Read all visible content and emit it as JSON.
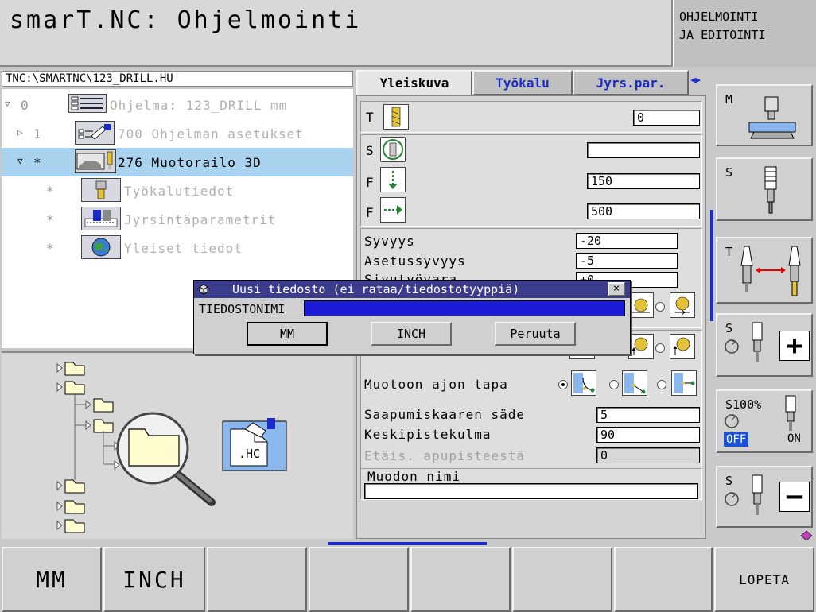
{
  "header": {
    "title": "smarT.NC: Ohjelmointi",
    "mode": "OHJELMOINTI\nJA EDITOINTI"
  },
  "tree": {
    "path": "TNC:\\SMARTNC\\123_DRILL.HU",
    "items": [
      {
        "num": "0",
        "label": "Ohjelma: 123_DRILL mm",
        "icon": "program-icon"
      },
      {
        "num": "1",
        "label": "700 Ohjelman asetukset",
        "icon": "program-settings-icon"
      },
      {
        "num": "*",
        "label": "276 Muotorailo 3D",
        "icon": "contour-train-icon"
      },
      {
        "num": "*",
        "label": "Työkalutiedot",
        "icon": "tool-data-icon"
      },
      {
        "num": "*",
        "label": "Jyrsintäparametrit",
        "icon": "milling-params-icon"
      },
      {
        "num": "*",
        "label": "Yleiset tiedot",
        "icon": "global-data-icon"
      }
    ]
  },
  "preview": {
    "file_ext": ".HC"
  },
  "tabs": [
    {
      "label": "Yleiskuva"
    },
    {
      "label": "Työkalu"
    },
    {
      "label": "Jyrs.par."
    }
  ],
  "form": {
    "tool": {
      "label": "T",
      "value": "0"
    },
    "spindle": {
      "label": "S",
      "value": ""
    },
    "feed_plunge": {
      "label": "F",
      "value": "150"
    },
    "feed_mill": {
      "label": "F",
      "value": "500"
    },
    "depth": {
      "label": "Syvyys",
      "value": "-20"
    },
    "plunge_depth": {
      "label": "Asetussyvyys",
      "value": "-5"
    },
    "third_partial": {
      "label": "Sivutyövara",
      "value": "+0"
    },
    "approach_mode": {
      "label": "Muotoon ajon tapa"
    },
    "approach_radius": {
      "label": "Saapumiskaaren säde",
      "value": "5"
    },
    "center_angle": {
      "label": "Keskipistekulma",
      "value": "90"
    },
    "aux_distance": {
      "label": "Etäis. apupisteestä",
      "value": "0"
    },
    "contour_name": {
      "label": "Muodon nimi",
      "value": ""
    }
  },
  "side_keys": {
    "m": "M",
    "s1": "S",
    "t": "T",
    "s2": "S",
    "s100": "S100%",
    "off": "OFF",
    "on": "ON",
    "s3": "S"
  },
  "bottom_keys": {
    "mm": "MM",
    "inch": "INCH",
    "exit": "LOPETA"
  },
  "dialog": {
    "title": "Uusi tiedosto (ei rataa/tiedostotyyppiä)",
    "close": "×",
    "filename_label": "TIEDOSTONIMI",
    "filename_value": "",
    "btn_mm": "MM",
    "btn_inch": "INCH",
    "btn_cancel": "Peruuta"
  },
  "colors": {
    "accent_blue": "#1a2cc8",
    "selection": "#a9d3ef",
    "dialog_title": "#3c3c8c",
    "off_badge": "#1a50d8"
  }
}
